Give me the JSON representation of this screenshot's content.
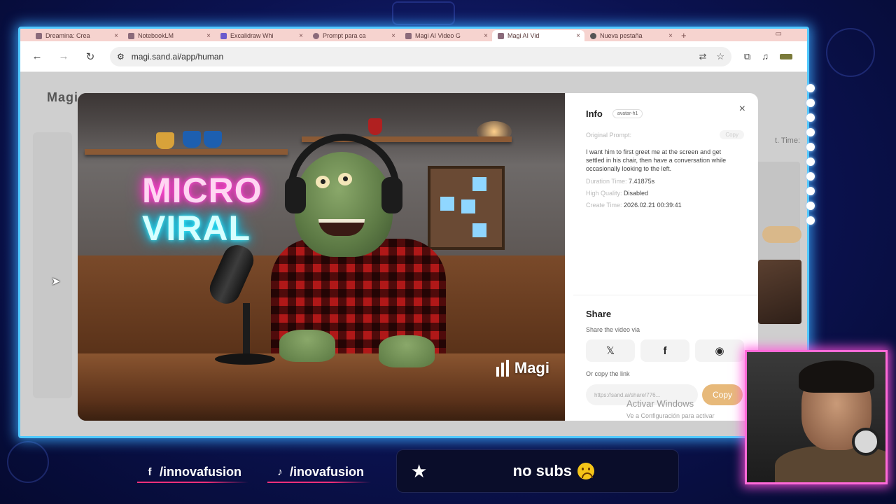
{
  "browser": {
    "tabs": [
      {
        "label": "Dreamina: Crea",
        "active": false
      },
      {
        "label": "NotebookLM",
        "active": false
      },
      {
        "label": "Excalidraw Whi",
        "active": false
      },
      {
        "label": "Prompt para ca",
        "active": false
      },
      {
        "label": "Magi AI Video G",
        "active": false
      },
      {
        "label": "Magi AI Vid",
        "active": true
      },
      {
        "label": "Nueva pestaña",
        "active": false
      }
    ],
    "url": "magi.sand.ai/app/human"
  },
  "page": {
    "logo": "Magi",
    "time_label": "t. Time:"
  },
  "video": {
    "neon_line1": "MICRO",
    "neon_line2": "VIRAL",
    "watermark": "Magi"
  },
  "info": {
    "title": "Info",
    "avatar_tag": "avatar-h1",
    "original_prompt_label": "Original Prompt:",
    "copy_label": "Copy",
    "prompt": "I want him to first greet me at the screen and get settled in his chair, then have a conversation while occasionally looking to the left.",
    "duration_label": "Duration Time:",
    "duration_value": "7.41875s",
    "quality_label": "High Quality:",
    "quality_value": "Disabled",
    "create_label": "Create Time:",
    "create_value": "2026.02.21 00:39:41"
  },
  "share": {
    "title": "Share",
    "subtitle": "Share the video via",
    "buttons": [
      {
        "icon": "x-logo-icon",
        "glyph": "𝕏"
      },
      {
        "icon": "facebook-icon",
        "glyph": "f"
      },
      {
        "icon": "reddit-icon",
        "glyph": "◉"
      }
    ],
    "or_copy": "Or copy the link",
    "link": "https://sand.ai/share/776...",
    "copy_button": "Copy"
  },
  "windows_watermark": {
    "line1": "Activar Windows",
    "line2": "Ve a Configuración para activar"
  },
  "overlay": {
    "facebook_handle": "/innovafusion",
    "tiktok_handle": "/inovafusion",
    "subs_text": "no subs"
  },
  "colors": {
    "frame_glow": "#4fc8ff",
    "webcam_glow": "#ff6ad8",
    "copy_button": "#e7b97a",
    "background": "#0b1250"
  }
}
